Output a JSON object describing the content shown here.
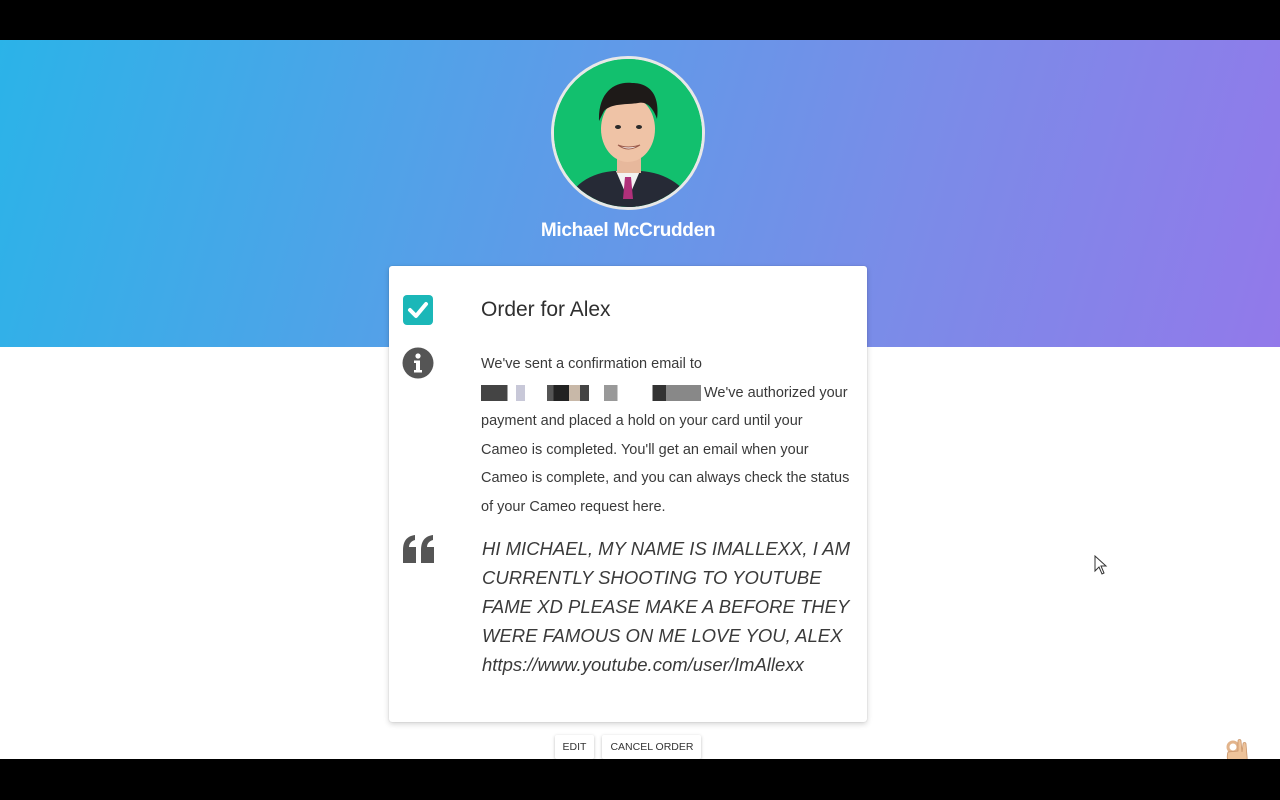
{
  "celebrity": {
    "name": "Michael McCrudden",
    "avatar": "avatar-photo"
  },
  "order": {
    "title": "Order for Alex",
    "status_icon": "checkbox-checked-icon",
    "info_icon": "info-circle-icon",
    "info_prefix": "We've sent a confirmation email to",
    "info_suffix": "We've authorized your payment and placed a hold on your card until your Cameo is completed. You'll get an email when your Cameo is complete, and you can always check the status of your Cameo request here.",
    "quote_icon": "quote-icon",
    "message": "HI MICHAEL, MY NAME IS IMALLEXX, I AM CURRENTLY SHOOTING TO YOUTUBE FAME XD PLEASE MAKE A BEFORE THEY WERE FAMOUS ON ME LOVE YOU, ALEX https://www.youtube.com/user/ImAllexx"
  },
  "actions": {
    "edit_label": "EDIT",
    "cancel_label": "CANCEL ORDER"
  },
  "colors": {
    "accent": "#1bb7b8",
    "gradient_start": "#2bb3e8",
    "gradient_end": "#9279ea"
  }
}
